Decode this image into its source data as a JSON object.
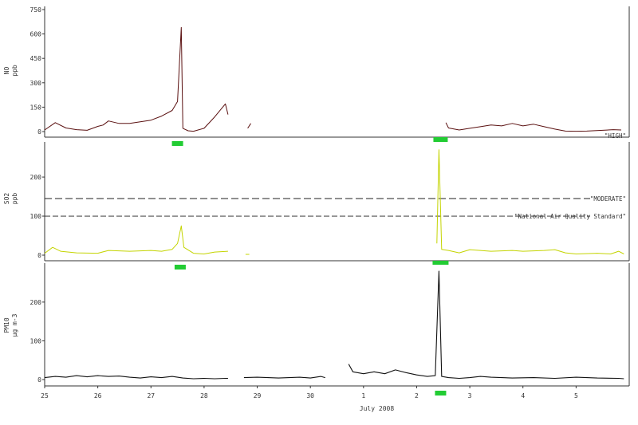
{
  "chart_data": [
    {
      "type": "line",
      "ylabel_line1": "NO",
      "ylabel_line2": "ppb",
      "ylim": [
        0,
        750
      ],
      "yticks": [
        0,
        150,
        300,
        450,
        600,
        750
      ],
      "color": "#5a1010",
      "segments": [
        [
          [
            25.0,
            10
          ],
          [
            25.2,
            55
          ],
          [
            25.4,
            22
          ],
          [
            25.6,
            12
          ],
          [
            25.8,
            8
          ],
          [
            26.0,
            32
          ],
          [
            26.1,
            40
          ],
          [
            26.2,
            65
          ],
          [
            26.4,
            50
          ],
          [
            26.6,
            50
          ],
          [
            26.8,
            60
          ],
          [
            27.0,
            70
          ],
          [
            27.2,
            95
          ],
          [
            27.4,
            130
          ],
          [
            27.5,
            185
          ],
          [
            27.57,
            640
          ],
          [
            27.6,
            20
          ],
          [
            27.7,
            5
          ],
          [
            27.8,
            2
          ],
          [
            28.0,
            20
          ],
          [
            28.2,
            90
          ],
          [
            28.4,
            170
          ],
          [
            28.45,
            105
          ]
        ],
        [
          [
            28.82,
            20
          ],
          [
            28.88,
            50
          ]
        ],
        [
          [
            32.55,
            55
          ],
          [
            32.6,
            22
          ],
          [
            32.8,
            10
          ],
          [
            33.0,
            20
          ],
          [
            33.2,
            30
          ],
          [
            33.4,
            40
          ],
          [
            33.6,
            35
          ],
          [
            33.8,
            50
          ],
          [
            34.0,
            35
          ],
          [
            34.2,
            45
          ],
          [
            34.4,
            30
          ],
          [
            34.6,
            15
          ],
          [
            34.8,
            3
          ],
          [
            35.0,
            2
          ],
          [
            35.2,
            3
          ],
          [
            35.5,
            8
          ],
          [
            35.7,
            12
          ],
          [
            35.85,
            10
          ]
        ]
      ],
      "markers": [
        27.5
      ],
      "threshold_lines": [
        {
          "label": "\"HIGH\"",
          "value": -30,
          "style": "dashed"
        }
      ]
    },
    {
      "type": "line",
      "ylabel_line1": "SO2",
      "ylabel_line2": "ppb",
      "ylim": [
        0,
        290
      ],
      "yticks": [
        0,
        100,
        200
      ],
      "color": "#c4d400",
      "segments": [
        [
          [
            25.0,
            5
          ],
          [
            25.15,
            20
          ],
          [
            25.3,
            10
          ],
          [
            25.6,
            6
          ],
          [
            26.0,
            5
          ],
          [
            26.2,
            12
          ],
          [
            26.6,
            10
          ],
          [
            27.0,
            12
          ],
          [
            27.2,
            10
          ],
          [
            27.4,
            15
          ],
          [
            27.5,
            30
          ],
          [
            27.57,
            75
          ],
          [
            27.62,
            20
          ],
          [
            27.8,
            5
          ],
          [
            28.0,
            3
          ],
          [
            28.2,
            8
          ],
          [
            28.45,
            10
          ]
        ],
        [
          [
            28.78,
            2
          ],
          [
            28.85,
            2
          ]
        ],
        [
          [
            32.38,
            30
          ],
          [
            32.42,
            270
          ],
          [
            32.47,
            15
          ],
          [
            32.6,
            12
          ],
          [
            32.8,
            6
          ],
          [
            33.0,
            14
          ],
          [
            33.4,
            10
          ],
          [
            33.8,
            12
          ],
          [
            34.0,
            10
          ],
          [
            34.4,
            12
          ],
          [
            34.6,
            14
          ],
          [
            34.8,
            6
          ],
          [
            35.0,
            3
          ],
          [
            35.4,
            5
          ],
          [
            35.65,
            3
          ],
          [
            35.8,
            10
          ],
          [
            35.9,
            3
          ]
        ]
      ],
      "markers": [
        27.55
      ],
      "threshold_lines": [
        {
          "label": "\"MODERATE\"",
          "value": 145,
          "style": "dashed"
        },
        {
          "label": "\"National Air Quality Standard\"",
          "value": 100,
          "style": "dashed"
        }
      ]
    },
    {
      "type": "line",
      "ylabel_line1": "PM10",
      "ylabel_line2": "µg m-3",
      "ylim": [
        0,
        280
      ],
      "yticks": [
        0,
        100,
        200
      ],
      "color": "#111111",
      "segments": [
        [
          [
            25.0,
            5
          ],
          [
            25.2,
            8
          ],
          [
            25.4,
            6
          ],
          [
            25.6,
            10
          ],
          [
            25.8,
            7
          ],
          [
            26.0,
            10
          ],
          [
            26.2,
            8
          ],
          [
            26.4,
            9
          ],
          [
            26.6,
            6
          ],
          [
            26.8,
            4
          ],
          [
            27.0,
            7
          ],
          [
            27.2,
            5
          ],
          [
            27.4,
            8
          ],
          [
            27.6,
            4
          ],
          [
            27.8,
            2
          ],
          [
            28.0,
            3
          ],
          [
            28.2,
            2
          ],
          [
            28.4,
            3
          ],
          [
            28.45,
            3
          ]
        ],
        [
          [
            28.75,
            5
          ],
          [
            29.0,
            6
          ],
          [
            29.4,
            4
          ],
          [
            29.8,
            6
          ],
          [
            30.0,
            4
          ],
          [
            30.2,
            8
          ],
          [
            30.28,
            5
          ]
        ],
        [
          [
            30.72,
            40
          ],
          [
            30.8,
            20
          ],
          [
            31.0,
            15
          ],
          [
            31.2,
            20
          ],
          [
            31.4,
            15
          ],
          [
            31.6,
            25
          ],
          [
            31.8,
            18
          ],
          [
            32.0,
            12
          ],
          [
            32.2,
            8
          ],
          [
            32.35,
            10
          ],
          [
            32.42,
            280
          ],
          [
            32.47,
            8
          ],
          [
            32.6,
            5
          ],
          [
            32.8,
            3
          ],
          [
            33.0,
            5
          ],
          [
            33.2,
            8
          ],
          [
            33.4,
            6
          ],
          [
            33.8,
            4
          ],
          [
            34.2,
            5
          ],
          [
            34.6,
            3
          ],
          [
            35.0,
            6
          ],
          [
            35.4,
            4
          ],
          [
            35.8,
            3
          ],
          [
            35.9,
            2
          ]
        ]
      ],
      "markers": [
        32.45
      ],
      "threshold_lines": []
    }
  ],
  "panel1_marker_top": [
    32.45
  ],
  "panel2_marker_top": [
    32.45
  ],
  "x_ticks": [
    {
      "x": 25.0,
      "label": "25"
    },
    {
      "x": 26.0,
      "label": "26"
    },
    {
      "x": 27.0,
      "label": "27"
    },
    {
      "x": 28.0,
      "label": "28"
    },
    {
      "x": 29.0,
      "label": "29"
    },
    {
      "x": 30.0,
      "label": "30"
    },
    {
      "x": 31.0,
      "label": "1"
    },
    {
      "x": 32.0,
      "label": "2"
    },
    {
      "x": 33.0,
      "label": "3"
    },
    {
      "x": 34.0,
      "label": "4"
    },
    {
      "x": 35.0,
      "label": "5"
    }
  ],
  "x_range": [
    25.0,
    36.0
  ],
  "xlabel": "July 2008",
  "colors": {
    "axis": "#333333",
    "marker": "#22cc33"
  }
}
